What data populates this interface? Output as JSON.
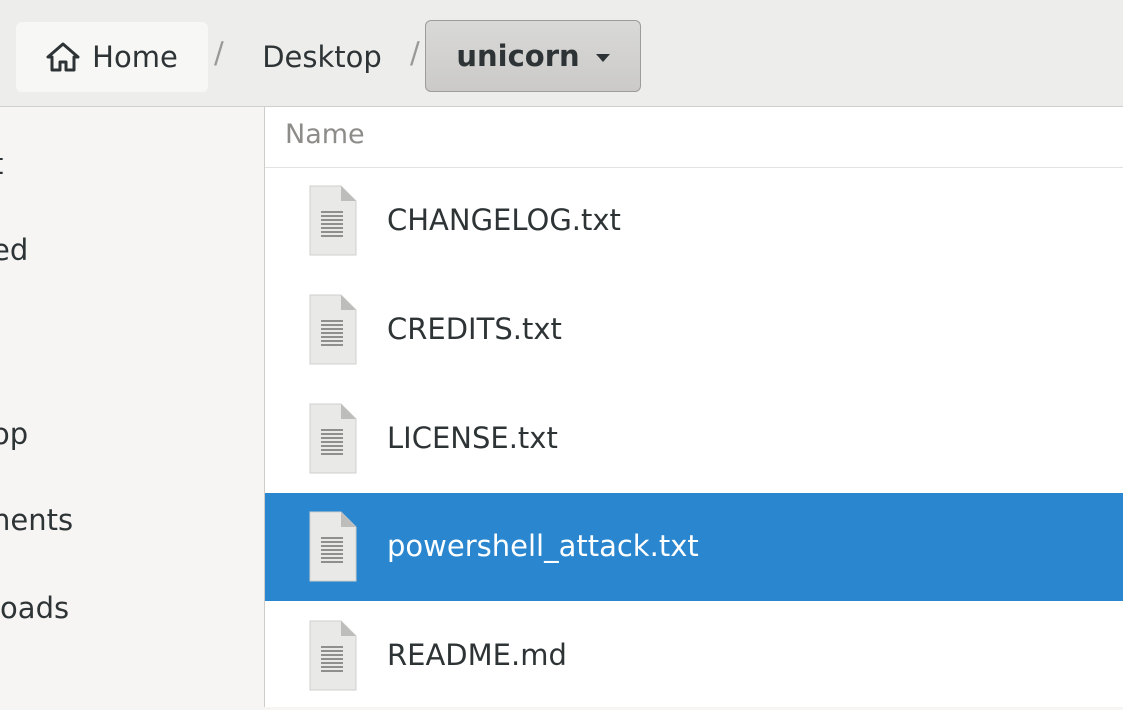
{
  "pathbar": {
    "home_label": "Home",
    "separator": "/",
    "desktop_label": "Desktop",
    "current_label": "unicorn"
  },
  "sidebar": {
    "items": [
      {
        "label": "t"
      },
      {
        "label": "ed"
      },
      {
        "label": "op"
      },
      {
        "label": "nents"
      },
      {
        "label": "loads"
      }
    ]
  },
  "filelist": {
    "column_name": "Name",
    "files": [
      {
        "name": "CHANGELOG.txt",
        "icon": "text-file-icon",
        "selected": false
      },
      {
        "name": "CREDITS.txt",
        "icon": "text-file-icon",
        "selected": false
      },
      {
        "name": "LICENSE.txt",
        "icon": "text-file-icon",
        "selected": false
      },
      {
        "name": "powershell_attack.txt",
        "icon": "text-file-icon",
        "selected": true
      },
      {
        "name": "README.md",
        "icon": "text-file-icon",
        "selected": false
      }
    ]
  },
  "colors": {
    "selection": "#2a87cf",
    "background": "#f6f5f4"
  }
}
